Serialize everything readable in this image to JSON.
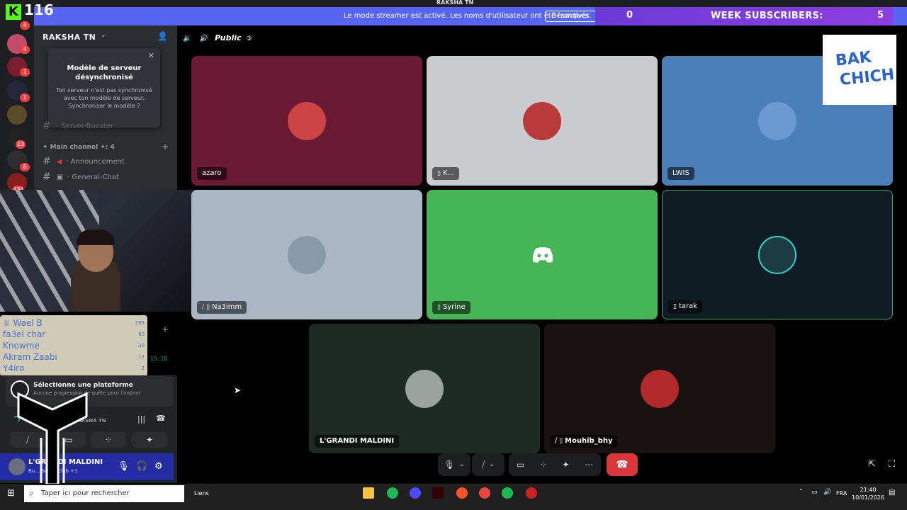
{
  "kick": {
    "count": "116"
  },
  "banner": {
    "message": "Le mode streamer est activé. Les noms d'utilisateur ont été tronqués.",
    "disable_button": "Désactiver",
    "color": "#5865f2"
  },
  "subs": {
    "left_count": "0",
    "label": "WEEK SUBSCRIBERS:",
    "count": "5"
  },
  "window_title": "RAKSHA TN",
  "server": {
    "name": "RAKSHA TN",
    "popup": {
      "title": "Modèle de serveur désynchronisé",
      "desc": "Ton serveur n'est pas synchronisé avec ton modèle de serveur. Synchroniser le modèle ?"
    },
    "category": "✦ Main channel ✦: 4",
    "channels": [
      "· Announcement",
      "· General-Chat"
    ],
    "partial_channel": "· Server-Booster"
  },
  "rail_badges": [
    "4",
    "4",
    "1",
    "1",
    "23",
    "6",
    "434"
  ],
  "stage": {
    "mode": "Public",
    "participants": [
      {
        "name": "azaro",
        "color": "#6b1a35",
        "icons": ""
      },
      {
        "name": "K...",
        "color": "#c9cbcf",
        "icons": "📱"
      },
      {
        "name": "LWIS",
        "color": "#4a7fb8",
        "icons": ""
      },
      {
        "name": "Na3imm",
        "color": "#a9b6c6",
        "icons": "⧸ 📱"
      },
      {
        "name": "Syrine",
        "color": "#45b556",
        "icons": "📱"
      },
      {
        "name": "tarak",
        "color": "#0f1c24",
        "icons": "📱"
      },
      {
        "name": "L'GRANDI MALDINI",
        "color": "#1e2a22",
        "icons": ""
      },
      {
        "name": "Mouhib_bhy",
        "color": "#1a1111",
        "icons": "⧸ 📱"
      }
    ]
  },
  "brand": {
    "line1": "BAK",
    "line2": "CHICH"
  },
  "leaderboard": [
    {
      "name": "Wael B",
      "value": "195"
    },
    {
      "name": "fa3el char",
      "value": "60"
    },
    {
      "name": "Knowme",
      "value": "30"
    },
    {
      "name": "Akram Zaabi",
      "value": "12"
    },
    {
      "name": "Y4iro",
      "value": "2"
    }
  ],
  "time_tag": "15:18",
  "activity": {
    "title": "Sélectionne une plateforme",
    "desc": "Aucune progression de quête pour l'instant"
  },
  "voice_connected": "RAKSHA TN",
  "user": {
    "name": "L'GRANDI MALDINI",
    "status": "Bu... Social Club +1"
  },
  "taskbar": {
    "search_placeholder": "Taper ici pour rechercher",
    "links": "Liens",
    "lang": "FRA",
    "time": "21:40",
    "date": "10/01/2026"
  }
}
